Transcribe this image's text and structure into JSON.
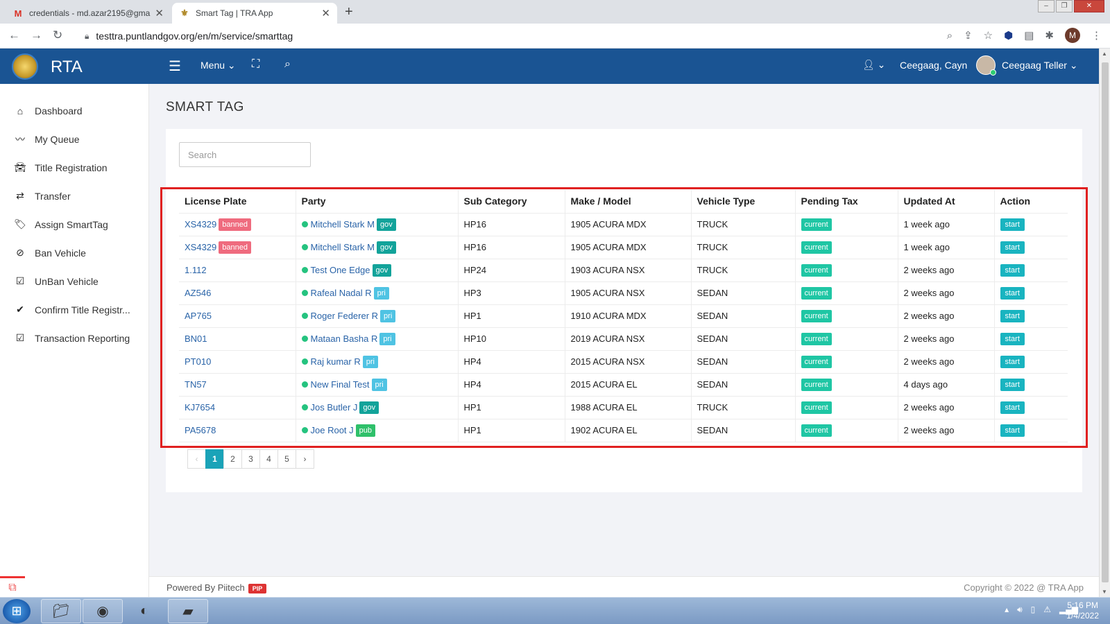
{
  "browser": {
    "tabs": [
      {
        "title": "credentials - md.azar2195@gmai",
        "icon": "gmail-icon"
      },
      {
        "title": "Smart Tag | TRA App",
        "icon": "emblem-icon"
      }
    ],
    "url": "testtra.puntlandgov.org/en/m/service/smarttag",
    "profile_initial": "M"
  },
  "header": {
    "brand": "RTA",
    "menu_label": "Menu",
    "user_name": "Ceegaag, Cayn",
    "role_name": "Ceegaag Teller",
    "brand_color": "#1a5493"
  },
  "sidebar": {
    "items": [
      {
        "label": "Dashboard",
        "icon": "home-icon"
      },
      {
        "label": "My Queue",
        "icon": "trend-icon"
      },
      {
        "label": "Title Registration",
        "icon": "car-icon"
      },
      {
        "label": "Transfer",
        "icon": "transfer-icon"
      },
      {
        "label": "Assign SmartTag",
        "icon": "tags-icon"
      },
      {
        "label": "Ban Vehicle",
        "icon": "ban-icon"
      },
      {
        "label": "UnBan Vehicle",
        "icon": "checkbox-icon"
      },
      {
        "label": "Confirm Title Registr...",
        "icon": "check-icon"
      },
      {
        "label": "Transaction Reporting",
        "icon": "checkbox-icon"
      }
    ]
  },
  "page": {
    "title": "SMART TAG",
    "search_placeholder": "Search"
  },
  "table": {
    "headers": [
      "License Plate",
      "Party",
      "Sub Category",
      "Make / Model",
      "Vehicle Type",
      "Pending Tax",
      "Updated At",
      "Action"
    ],
    "rows": [
      {
        "plate": "XS4329",
        "plate_badge": "banned",
        "party": "Mitchell Stark M",
        "party_badge": "gov",
        "sub": "HP16",
        "make": "1905 ACURA MDX",
        "type": "TRUCK",
        "tax": "current",
        "updated": "1 week ago",
        "action": "start"
      },
      {
        "plate": "XS4329",
        "plate_badge": "banned",
        "party": "Mitchell Stark M",
        "party_badge": "gov",
        "sub": "HP16",
        "make": "1905 ACURA MDX",
        "type": "TRUCK",
        "tax": "current",
        "updated": "1 week ago",
        "action": "start"
      },
      {
        "plate": "1.112",
        "plate_badge": "",
        "party": "Test One Edge",
        "party_badge": "gov",
        "sub": "HP24",
        "make": "1903 ACURA NSX",
        "type": "TRUCK",
        "tax": "current",
        "updated": "2 weeks ago",
        "action": "start"
      },
      {
        "plate": "AZ546",
        "plate_badge": "",
        "party": "Rafeal Nadal R",
        "party_badge": "pri",
        "sub": "HP3",
        "make": "1905 ACURA NSX",
        "type": "SEDAN",
        "tax": "current",
        "updated": "2 weeks ago",
        "action": "start"
      },
      {
        "plate": "AP765",
        "plate_badge": "",
        "party": "Roger Federer R",
        "party_badge": "pri",
        "sub": "HP1",
        "make": "1910 ACURA MDX",
        "type": "SEDAN",
        "tax": "current",
        "updated": "2 weeks ago",
        "action": "start"
      },
      {
        "plate": "BN01",
        "plate_badge": "",
        "party": "Mataan Basha R",
        "party_badge": "pri",
        "sub": "HP10",
        "make": "2019 ACURA NSX",
        "type": "SEDAN",
        "tax": "current",
        "updated": "2 weeks ago",
        "action": "start"
      },
      {
        "plate": "PT010",
        "plate_badge": "",
        "party": "Raj kumar R",
        "party_badge": "pri",
        "sub": "HP4",
        "make": "2015 ACURA NSX",
        "type": "SEDAN",
        "tax": "current",
        "updated": "2 weeks ago",
        "action": "start"
      },
      {
        "plate": "TN57",
        "plate_badge": "",
        "party": "New Final Test",
        "party_badge": "pri",
        "sub": "HP4",
        "make": "2015 ACURA EL",
        "type": "SEDAN",
        "tax": "current",
        "updated": "4 days ago",
        "action": "start"
      },
      {
        "plate": "KJ7654",
        "plate_badge": "",
        "party": "Jos Butler J",
        "party_badge": "gov",
        "sub": "HP1",
        "make": "1988 ACURA EL",
        "type": "TRUCK",
        "tax": "current",
        "updated": "2 weeks ago",
        "action": "start"
      },
      {
        "plate": "PA5678",
        "plate_badge": "",
        "party": "Joe Root J",
        "party_badge": "pub",
        "sub": "HP1",
        "make": "1902 ACURA EL",
        "type": "SEDAN",
        "tax": "current",
        "updated": "2 weeks ago",
        "action": "start"
      }
    ]
  },
  "pagination": {
    "prev": "‹",
    "pages": [
      "1",
      "2",
      "3",
      "4",
      "5"
    ],
    "current": "1",
    "next": "›"
  },
  "footer": {
    "powered_by": "Powered By Piitech",
    "badge": "PIP",
    "copyright": "Copyright © 2022 @ TRA App"
  },
  "taskbar": {
    "time": "5:16 PM",
    "date": "1/4/2022"
  }
}
